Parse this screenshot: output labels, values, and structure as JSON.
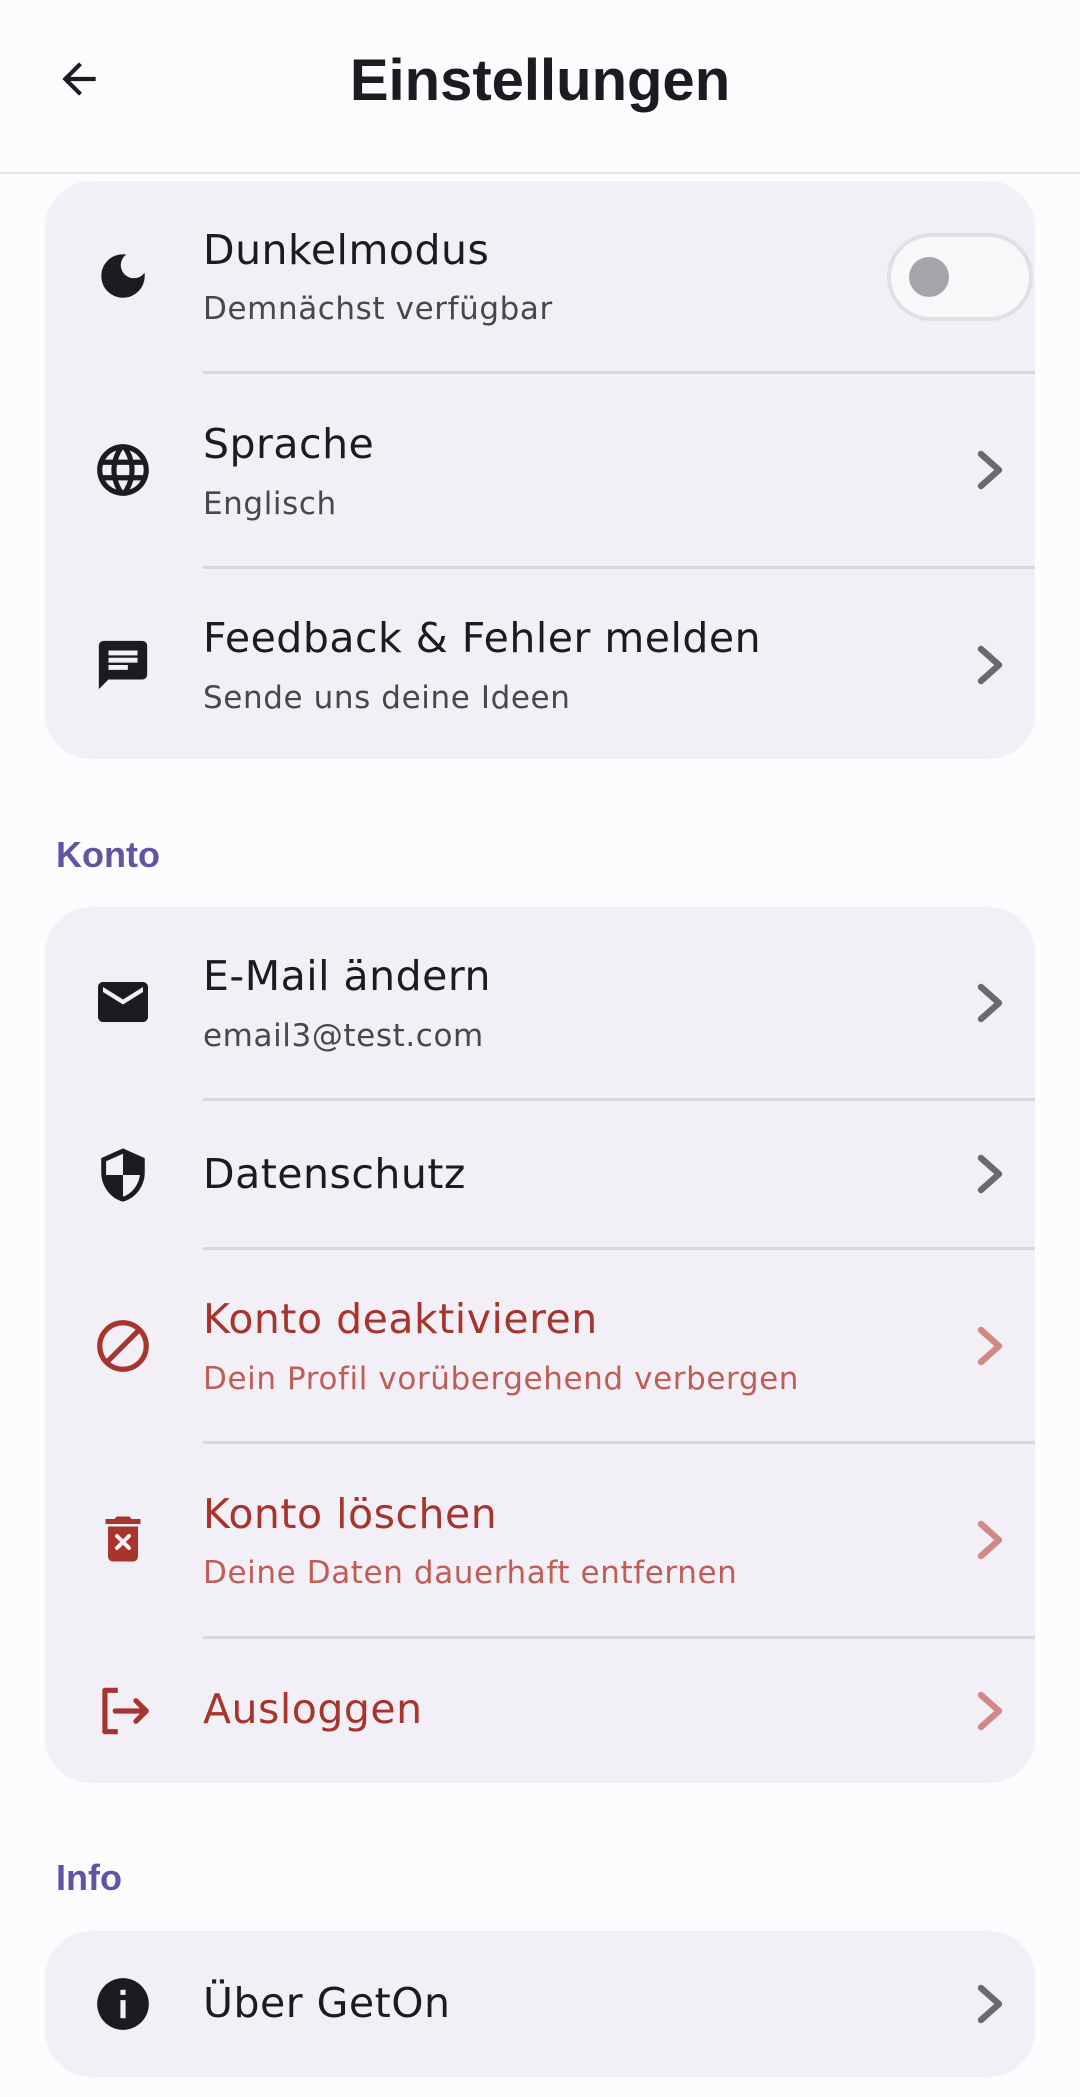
{
  "app_bar": {
    "title": "Einstellungen",
    "back_icon": "arrow-back-icon"
  },
  "general": {
    "items": [
      {
        "label": "Dunkelmodus",
        "sub": "Demnächst verfügbar",
        "icon": "moon-icon",
        "toggle": false
      },
      {
        "label": "Sprache",
        "sub": "Englisch",
        "icon": "globe-icon"
      },
      {
        "label": "Feedback & Fehler melden",
        "sub": "Sende uns deine Ideen",
        "icon": "feedback-icon"
      }
    ]
  },
  "konto": {
    "header": "Konto",
    "items": [
      {
        "label": "E-Mail ändern",
        "sub": "email3@test.com",
        "icon": "mail-icon"
      },
      {
        "label": "Datenschutz",
        "icon": "shield-icon"
      },
      {
        "label": "Konto deaktivieren",
        "sub": "Dein Profil vorübergehend verbergen",
        "icon": "block-icon"
      },
      {
        "label": "Konto löschen",
        "sub": "Deine Daten dauerhaft entfernen",
        "icon": "delete-icon"
      },
      {
        "label": "Ausloggen",
        "icon": "logout-icon"
      }
    ]
  },
  "info": {
    "header": "Info",
    "items": [
      {
        "label": "Über GetOn",
        "icon": "info-icon"
      }
    ]
  },
  "colors": {
    "accent": "#5f55a0",
    "danger": "#a6352e",
    "card": "#f3eff6"
  }
}
